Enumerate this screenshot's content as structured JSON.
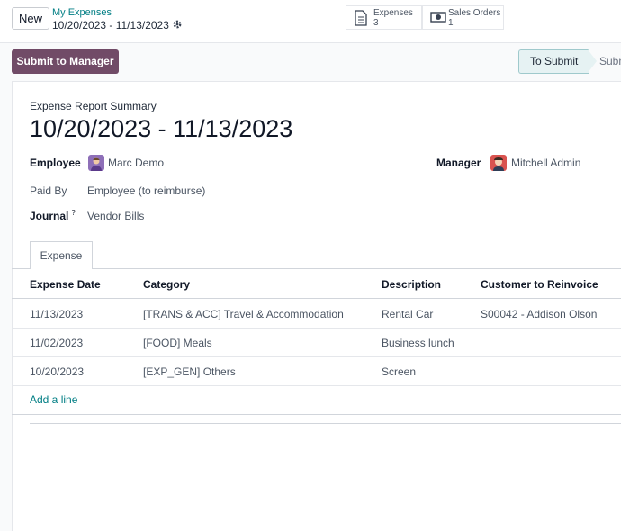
{
  "toolbar": {
    "new_label": "New",
    "breadcrumb": "My Expenses",
    "record_title": "10/20/2023 - 11/13/2023",
    "gear_icon": "gear-icon"
  },
  "smart_buttons": {
    "expenses": {
      "label": "Expenses",
      "count": "3",
      "icon": "document-icon"
    },
    "sales_orders": {
      "label": "Sales Orders",
      "count": "1",
      "icon": "money-icon"
    }
  },
  "actions": {
    "submit_label": "Submit to Manager"
  },
  "statusbar": {
    "current": "To Submit",
    "next": "Submitted"
  },
  "form": {
    "summary_label": "Expense Report Summary",
    "title": "10/20/2023 - 11/13/2023",
    "employee_label": "Employee",
    "employee_value": "Marc Demo",
    "manager_label": "Manager",
    "manager_value": "Mitchell Admin",
    "paid_by_label": "Paid By",
    "paid_by_value": "Employee (to reimburse)",
    "journal_label": "Journal",
    "journal_help": "?",
    "journal_value": "Vendor Bills"
  },
  "tabs": [
    {
      "label": "Expense"
    }
  ],
  "table": {
    "headers": [
      "Expense Date",
      "Category",
      "Description",
      "Customer to Reinvoice"
    ],
    "rows": [
      [
        "11/13/2023",
        "[TRANS & ACC] Travel & Accommodation",
        "Rental Car",
        "S00042 - Addison Olson"
      ],
      [
        "11/02/2023",
        "[FOOD] Meals",
        "Business lunch",
        ""
      ],
      [
        "10/20/2023",
        "[EXP_GEN] Others",
        "Screen",
        ""
      ]
    ],
    "add_line": "Add a line"
  },
  "colors": {
    "brand": "#714b67",
    "link": "#017e84",
    "status_active_bg": "#e6f2f3"
  }
}
